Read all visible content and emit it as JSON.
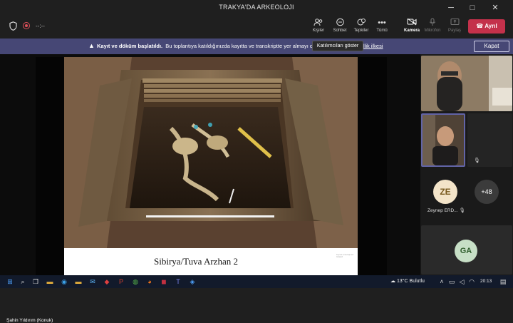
{
  "window": {
    "title": "TRAKYA'DA ARKEOLOJI",
    "minimize": "─",
    "maximize": "□",
    "close": "✕"
  },
  "toolbar": {
    "timer": "--:--",
    "participants_label": "Kişiler",
    "chat_label": "Sohbet",
    "reactions_label": "Tepkiler",
    "more_label": "Tümü",
    "camera_label": "Kamera",
    "mic_label": "Mikrofon",
    "share_label": "Paylaş",
    "leave_label": "Ayrıl"
  },
  "banner": {
    "title": "Kayıt ve döküm başlatıldı.",
    "message": "Bu toplantıya katıldığınızda kayıtta ve transkriptte yer almayı on",
    "link": "llik ilkesi",
    "close_label": "Kapat"
  },
  "tooltip": {
    "text": "Katılımcıları göster"
  },
  "slide": {
    "caption": "Sibirya/Tuva Arzhan 2",
    "note": "Kaynak: arkeoloji kazı fotoğrafı"
  },
  "presenter": {
    "name": "Şahin Yıldırım (Konuk)"
  },
  "participants": {
    "ze_initials": "ZE",
    "ze_name": "Zeynep ERD...",
    "more_count": "+48",
    "ga_initials": "GA"
  },
  "taskbar": {
    "weather": "13°C  Bulutlu",
    "time": "20:13"
  },
  "colors": {
    "leave_red": "#c4314b",
    "banner_purple": "#464775",
    "accent": "#6264a7"
  }
}
